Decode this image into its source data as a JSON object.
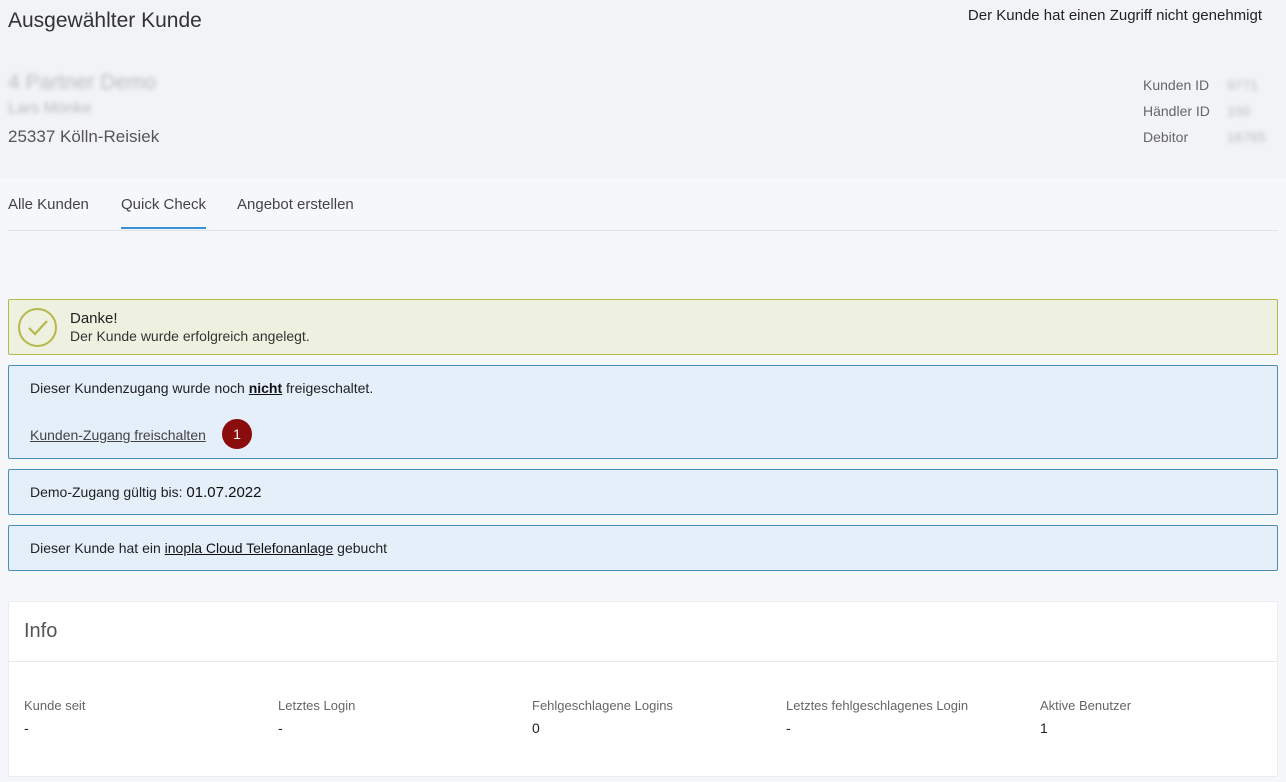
{
  "header": {
    "title": "Ausgewählter Kunde",
    "access_note": "Der Kunde hat einen Zugriff nicht genehmigt",
    "customer": {
      "name": "4 Partner Demo",
      "contact": "Lars Mönke",
      "city": "25337 Kölln-Reisiek"
    },
    "meta": [
      {
        "label": "Kunden ID",
        "value": "9771"
      },
      {
        "label": "Händler ID",
        "value": "100"
      },
      {
        "label": "Debitor",
        "value": "16765"
      }
    ]
  },
  "tabs": [
    {
      "label": "Alle Kunden",
      "active": false
    },
    {
      "label": "Quick Check",
      "active": true
    },
    {
      "label": "Angebot erstellen",
      "active": false
    }
  ],
  "success": {
    "title": "Danke!",
    "text": "Der Kunde wurde erfolgreich angelegt.",
    "color": "#b5b84a"
  },
  "unlock": {
    "text_before": "Dieser Kundenzugang wurde noch ",
    "text_emph": "nicht",
    "text_after": " freigeschaltet.",
    "link": "Kunden-Zugang freischalten",
    "badge": "1"
  },
  "demo": {
    "label": "Demo-Zugang gültig bis: ",
    "date": "01.07.2022"
  },
  "product": {
    "text_before": "Dieser Kunde hat ein ",
    "product_link": "inopla Cloud Telefonanlage",
    "text_after": " gebucht"
  },
  "info": {
    "title": "Info",
    "stats": [
      {
        "label": "Kunde seit",
        "value": "-"
      },
      {
        "label": "Letztes Login",
        "value": "-"
      },
      {
        "label": "Fehlgeschlagene Logins",
        "value": "0"
      },
      {
        "label": "Letztes fehlgeschlagenes Login",
        "value": "-"
      },
      {
        "label": "Aktive Benutzer",
        "value": "1"
      }
    ]
  },
  "colors": {
    "accent": "#3a8fd6",
    "info_bg": "#e4effa",
    "info_border": "#4a8fb8",
    "badge": "#8b0c0c"
  }
}
